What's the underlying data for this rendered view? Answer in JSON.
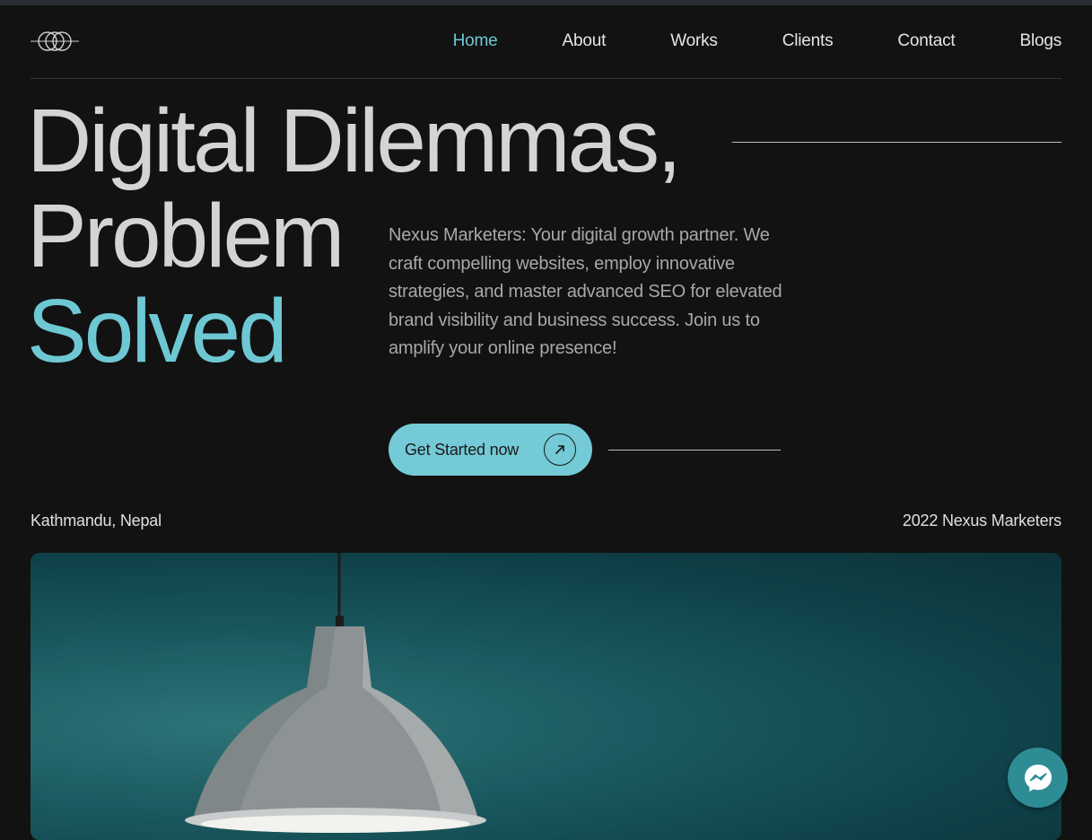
{
  "brand": {
    "logo_icon": "triple-ring-logo-icon",
    "accent": "#6ec8d4"
  },
  "nav": {
    "items": [
      {
        "label": "Home",
        "active": true
      },
      {
        "label": "About",
        "active": false
      },
      {
        "label": "Works",
        "active": false
      },
      {
        "label": "Clients",
        "active": false
      },
      {
        "label": "Contact",
        "active": false
      },
      {
        "label": "Blogs",
        "active": false
      }
    ]
  },
  "hero": {
    "line1": "Digital Dilemmas,",
    "line2": "Problem",
    "line3": "Solved",
    "description": "Nexus Marketers: Your digital growth partner. We craft compelling websites, employ innovative strategies, and master advanced SEO for elevated brand visibility and business success. Join us to amplify your online presence!",
    "cta_label": "Get Started now",
    "cta_icon": "arrow-up-right-icon"
  },
  "footer_row": {
    "location": "Kathmandu, Nepal",
    "copyright": "2022 Nexus Marketers"
  },
  "media": {
    "image_subject": "pendant-lamp-photo"
  },
  "chat": {
    "icon": "messenger-icon",
    "color": "#2d8c94"
  }
}
